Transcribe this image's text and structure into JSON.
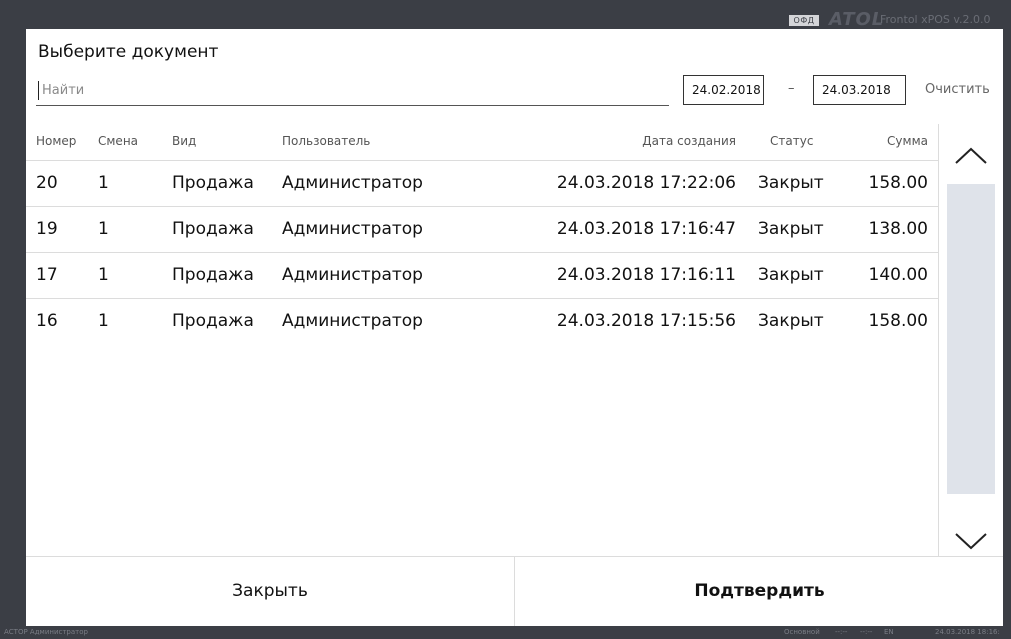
{
  "app": {
    "ofd_badge": "ОФД",
    "logo": "ATOL",
    "version": "Frontol xPOS v.2.0.0"
  },
  "dialog": {
    "title": "Выберите документ",
    "search_placeholder": "Найти",
    "date_from": "24.02.2018",
    "date_separator": "–",
    "date_to": "24.03.2018",
    "clear_label": "Очистить"
  },
  "table": {
    "columns": [
      "Номер",
      "Смена",
      "Вид",
      "Пользователь",
      "Дата создания",
      "Статус",
      "Сумма"
    ],
    "rows": [
      {
        "number": "20",
        "shift": "1",
        "type": "Продажа",
        "user": "Администратор",
        "created": "24.03.2018 17:22:06",
        "status": "Закрыт",
        "sum": "158.00"
      },
      {
        "number": "19",
        "shift": "1",
        "type": "Продажа",
        "user": "Администратор",
        "created": "24.03.2018 17:16:47",
        "status": "Закрыт",
        "sum": "138.00"
      },
      {
        "number": "17",
        "shift": "1",
        "type": "Продажа",
        "user": "Администратор",
        "created": "24.03.2018 17:16:11",
        "status": "Закрыт",
        "sum": "140.00"
      },
      {
        "number": "16",
        "shift": "1",
        "type": "Продажа",
        "user": "Администратор",
        "created": "24.03.2018 17:15:56",
        "status": "Закрыт",
        "sum": "158.00"
      }
    ]
  },
  "scroll": {
    "up_icon": "chevron-up-icon",
    "down_icon": "chevron-down-icon"
  },
  "footer": {
    "close_label": "Закрыть",
    "confirm_label": "Подтвердить"
  },
  "statusbar": {
    "user": "АСТОР Администратор",
    "mode": "Основной",
    "indicator_1": "--:--",
    "indicator_2": "--:--",
    "lang": "EN",
    "datetime": "24.03.2018 18:16:"
  },
  "colors": {
    "frame": "#3b3e45",
    "dialog_bg": "#ffffff",
    "scroll_track": "#dfe3ea",
    "divider": "#dcdcdc"
  }
}
